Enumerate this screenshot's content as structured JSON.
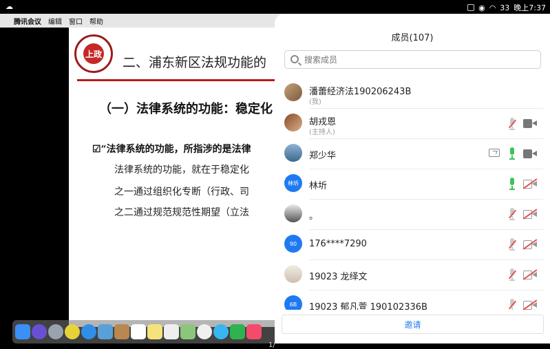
{
  "status_bar": {
    "time": "晚上7:37",
    "battery": "33"
  },
  "mac": {
    "menu": {
      "app": "腾讯会议",
      "items": [
        "编辑",
        "窗口",
        "帮助"
      ]
    },
    "slide": {
      "logo_text": "上政",
      "title": "二、浦东新区法规功能的",
      "subtitle": "（一）法律系统的功能：稳定化",
      "bullet": "☑“法律系统的功能，所指涉的是法律",
      "lines": [
        "法律系统的功能，就在于稳定化",
        "之一通过组织化专断（行政、司",
        "之二通过规范规范性期望（立法"
      ]
    },
    "page_indicator": "1/"
  },
  "panel": {
    "title": "成员(107)",
    "search_placeholder": "搜索成员",
    "invite_label": "邀请",
    "members": [
      {
        "name": "潘蕾经济法190206243B",
        "role": "(我)",
        "avatar": "photo",
        "mic": "none",
        "cam": "none",
        "share": false
      },
      {
        "name": "胡戎恩",
        "role": "(主持人)",
        "avatar": "photo",
        "mic": "muted",
        "cam": "on",
        "share": false
      },
      {
        "name": "郑少华",
        "role": "",
        "avatar": "photo",
        "mic": "on",
        "cam": "on",
        "share": true
      },
      {
        "name": "林圻",
        "role": "",
        "avatar": "blue",
        "avatar_text": "林圻",
        "mic": "on",
        "cam": "off",
        "share": false
      },
      {
        "name": "。",
        "role": "",
        "avatar": "photo",
        "mic": "muted",
        "cam": "off",
        "share": false
      },
      {
        "name": "176****7290",
        "role": "",
        "avatar": "blue",
        "avatar_text": "90",
        "mic": "muted",
        "cam": "off",
        "share": false
      },
      {
        "name": "19023 龙绎文",
        "role": "",
        "avatar": "photo",
        "mic": "muted",
        "cam": "off",
        "share": false
      },
      {
        "name": "19023 郁凡萱 190102336B",
        "role": "",
        "avatar": "blue",
        "avatar_text": "6B",
        "mic": "muted",
        "cam": "off",
        "share": false
      }
    ]
  }
}
